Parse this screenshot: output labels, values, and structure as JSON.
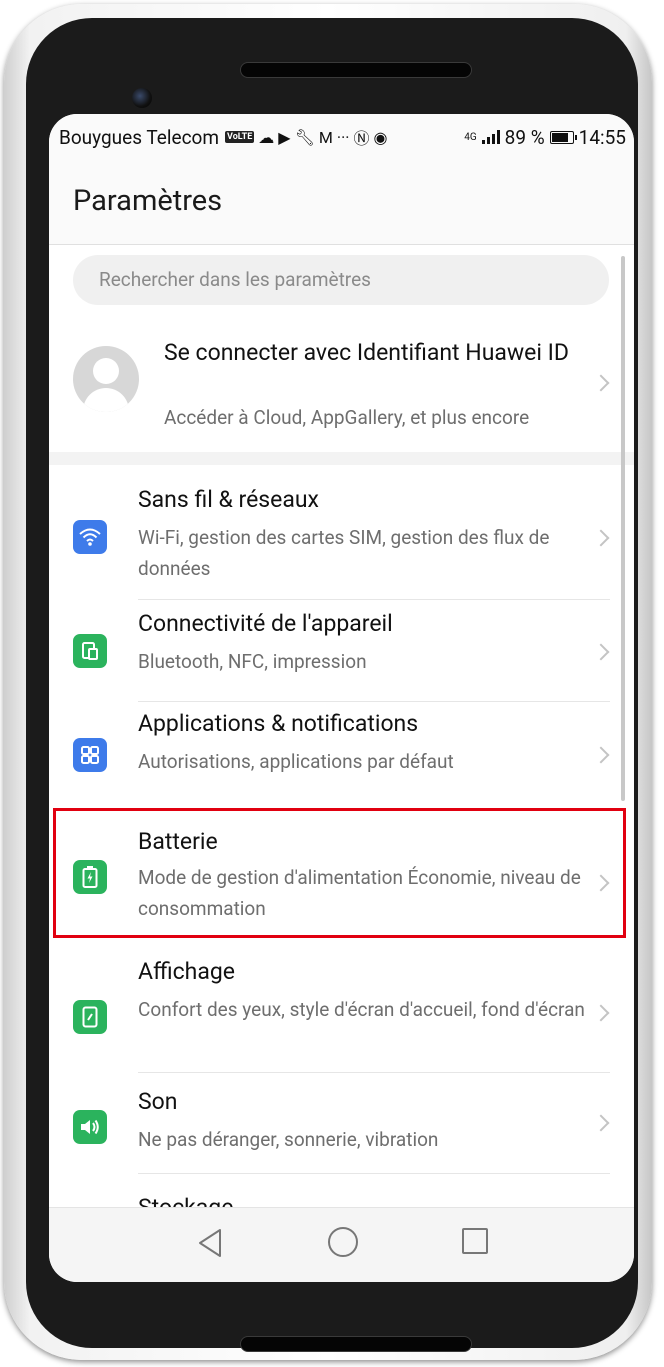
{
  "status_bar": {
    "carrier": "Bouygues Telecom",
    "volte_badge": "VoLTE",
    "network_label": "4G",
    "battery_percent": "89 %",
    "battery_level": 0.89,
    "time": "14:55",
    "notification_icons": [
      "cloud-icon",
      "play-store-icon",
      "wrench-icon",
      "gmail-icon",
      "more-icon",
      "nfc-icon",
      "eye-icon",
      "signal-icon"
    ]
  },
  "header": {
    "title": "Paramètres"
  },
  "search": {
    "placeholder": "Rechercher dans les paramètres"
  },
  "account": {
    "title": "Se connecter avec Identifiant Huawei ID",
    "subtitle": "Accéder à Cloud, AppGallery, et plus encore"
  },
  "settings": [
    {
      "title": "Sans fil & réseaux",
      "subtitle": "Wi-Fi, gestion des cartes SIM, gestion des flux de données",
      "icon": "wifi-icon",
      "color": "#3e7bea"
    },
    {
      "title": "Connectivité de l'appareil",
      "subtitle": "Bluetooth, NFC, impression",
      "icon": "device-connectivity-icon",
      "color": "#2bb35d"
    },
    {
      "title": "Applications & notifications",
      "subtitle": "Autorisations, applications par défaut",
      "icon": "apps-grid-icon",
      "color": "#3e7bea"
    },
    {
      "title": "Batterie",
      "subtitle": "Mode de gestion d'alimentation Économie, niveau de consommation",
      "icon": "battery-icon",
      "color": "#2bb35d"
    },
    {
      "title": "Affichage",
      "subtitle": "Confort des yeux, style d'écran d'accueil, fond d'écran",
      "icon": "display-icon",
      "color": "#2bb35d"
    },
    {
      "title": "Son",
      "subtitle": "Ne pas déranger, sonnerie, vibration",
      "icon": "speaker-icon",
      "color": "#2bb35d"
    }
  ],
  "partial_next_item": "Stockage",
  "highlight_color": "#e10010",
  "navigation": {
    "back_icon": "back-triangle-icon",
    "home_icon": "home-circle-icon",
    "recents_icon": "recents-square-icon"
  }
}
